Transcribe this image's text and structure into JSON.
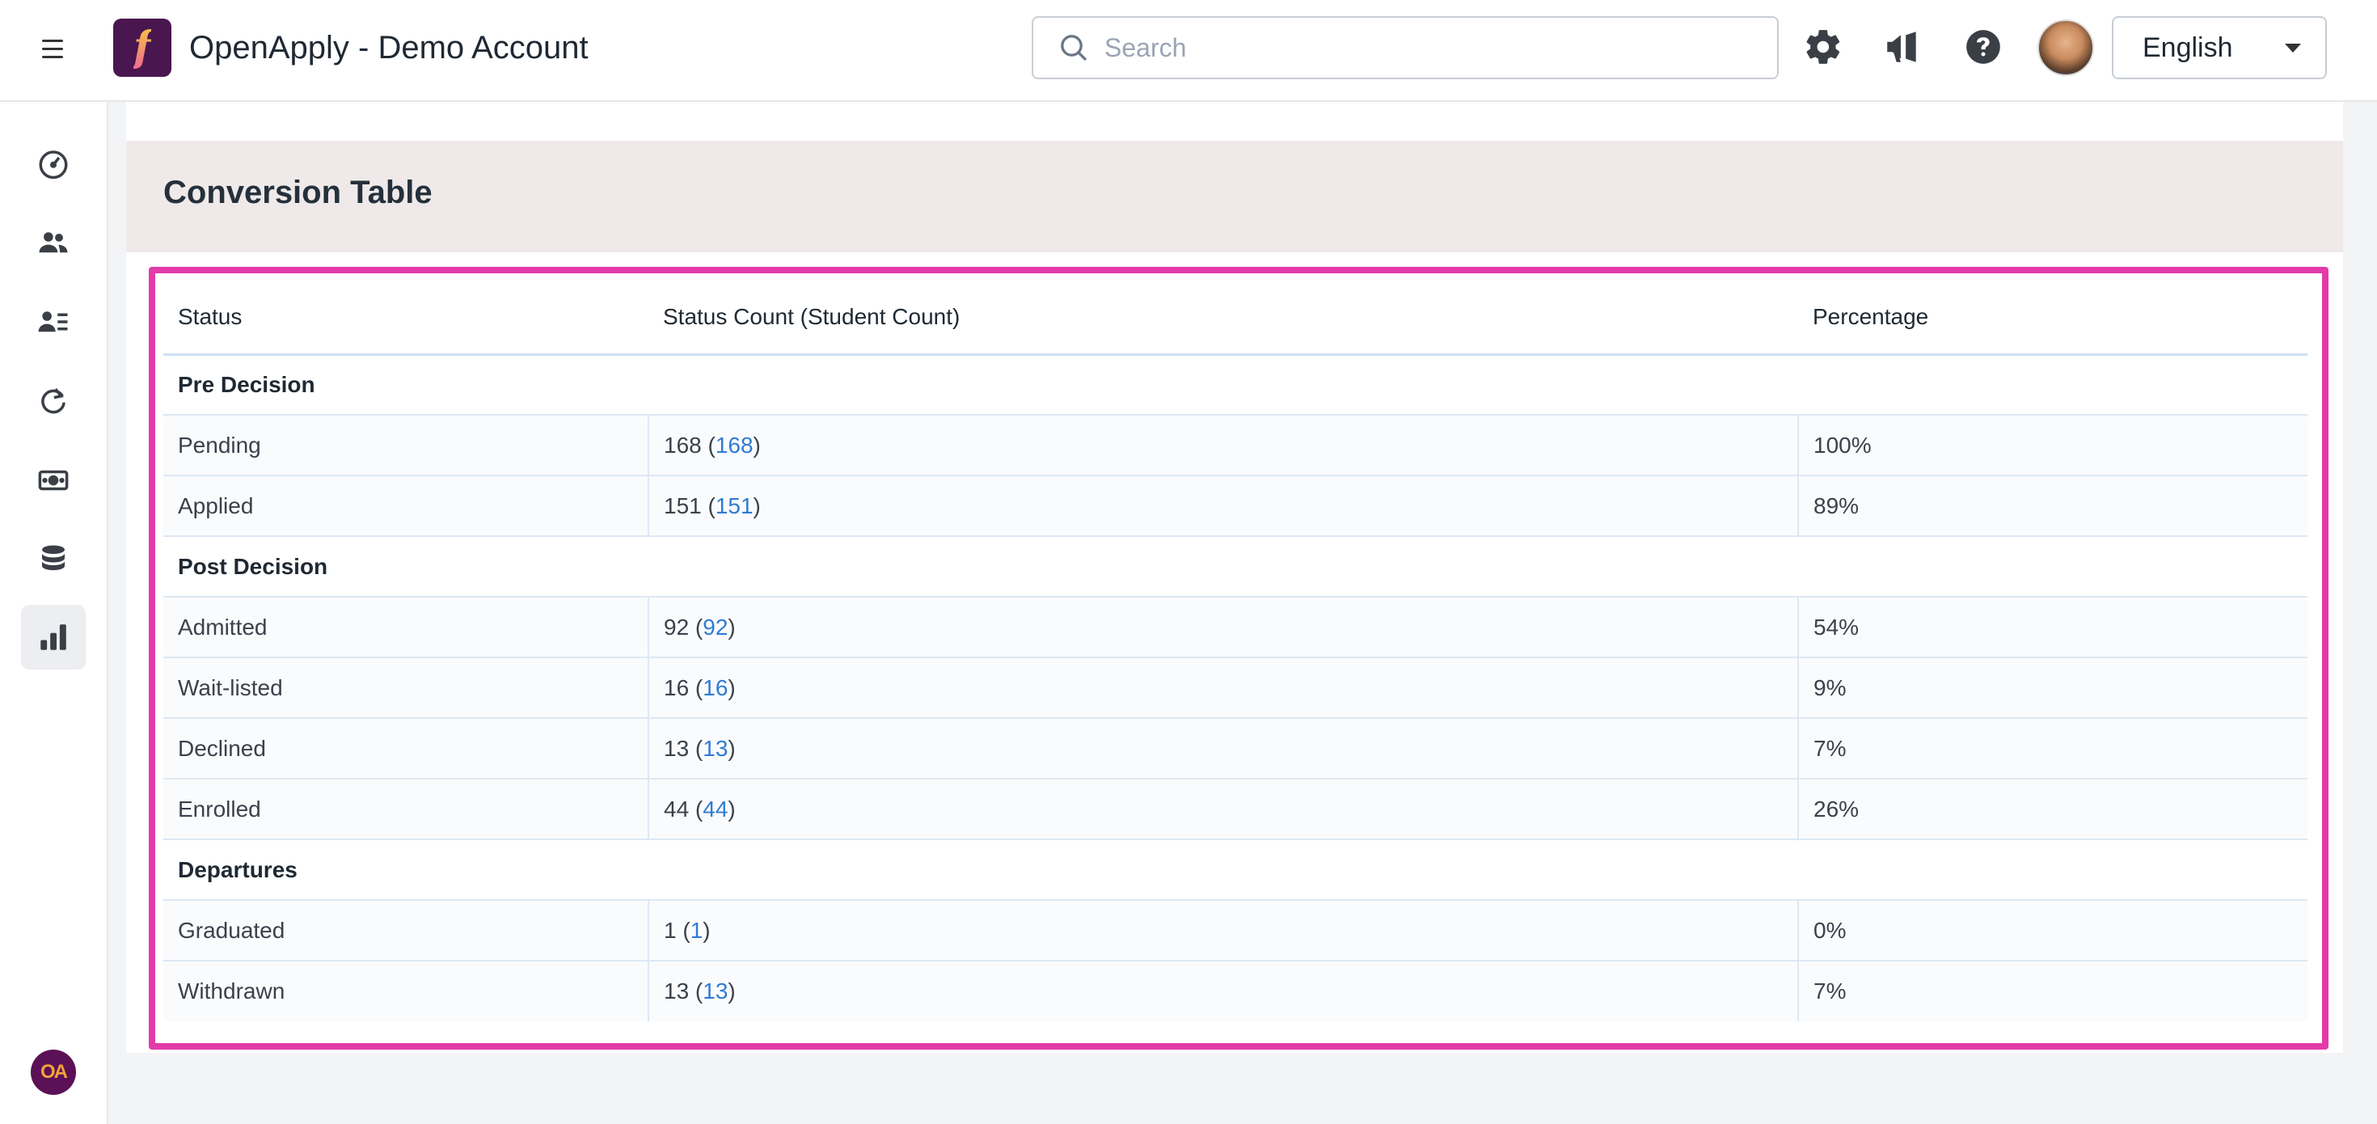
{
  "header": {
    "app_title": "OpenApply - Demo Account",
    "search_placeholder": "Search",
    "language": "English"
  },
  "panel": {
    "title": "Conversion Table"
  },
  "table": {
    "columns": [
      "Status",
      "Status Count (Student Count)",
      "Percentage"
    ],
    "groups": [
      {
        "name": "Pre Decision",
        "rows": [
          {
            "status": "Pending",
            "count": "168",
            "students": "168",
            "percentage": "100%"
          },
          {
            "status": "Applied",
            "count": "151",
            "students": "151",
            "percentage": "89%"
          }
        ]
      },
      {
        "name": "Post Decision",
        "rows": [
          {
            "status": "Admitted",
            "count": "92",
            "students": "92",
            "percentage": "54%"
          },
          {
            "status": "Wait-listed",
            "count": "16",
            "students": "16",
            "percentage": "9%"
          },
          {
            "status": "Declined",
            "count": "13",
            "students": "13",
            "percentage": "7%"
          },
          {
            "status": "Enrolled",
            "count": "44",
            "students": "44",
            "percentage": "26%"
          }
        ]
      },
      {
        "name": "Departures",
        "rows": [
          {
            "status": "Graduated",
            "count": "1",
            "students": "1",
            "percentage": "0%"
          },
          {
            "status": "Withdrawn",
            "count": "13",
            "students": "13",
            "percentage": "7%"
          }
        ]
      }
    ]
  },
  "sidebar": {
    "items": [
      {
        "icon": "dashboard-gauge-icon"
      },
      {
        "icon": "users-icon"
      },
      {
        "icon": "student-list-icon"
      },
      {
        "icon": "refresh-icon"
      },
      {
        "icon": "payments-icon"
      },
      {
        "icon": "database-icon"
      },
      {
        "icon": "reports-chart-icon",
        "active": true
      }
    ],
    "badge_text": "OA"
  },
  "colors": {
    "highlight": "#e33ba9",
    "link": "#2f7bd3",
    "brand": "#4a1650"
  }
}
